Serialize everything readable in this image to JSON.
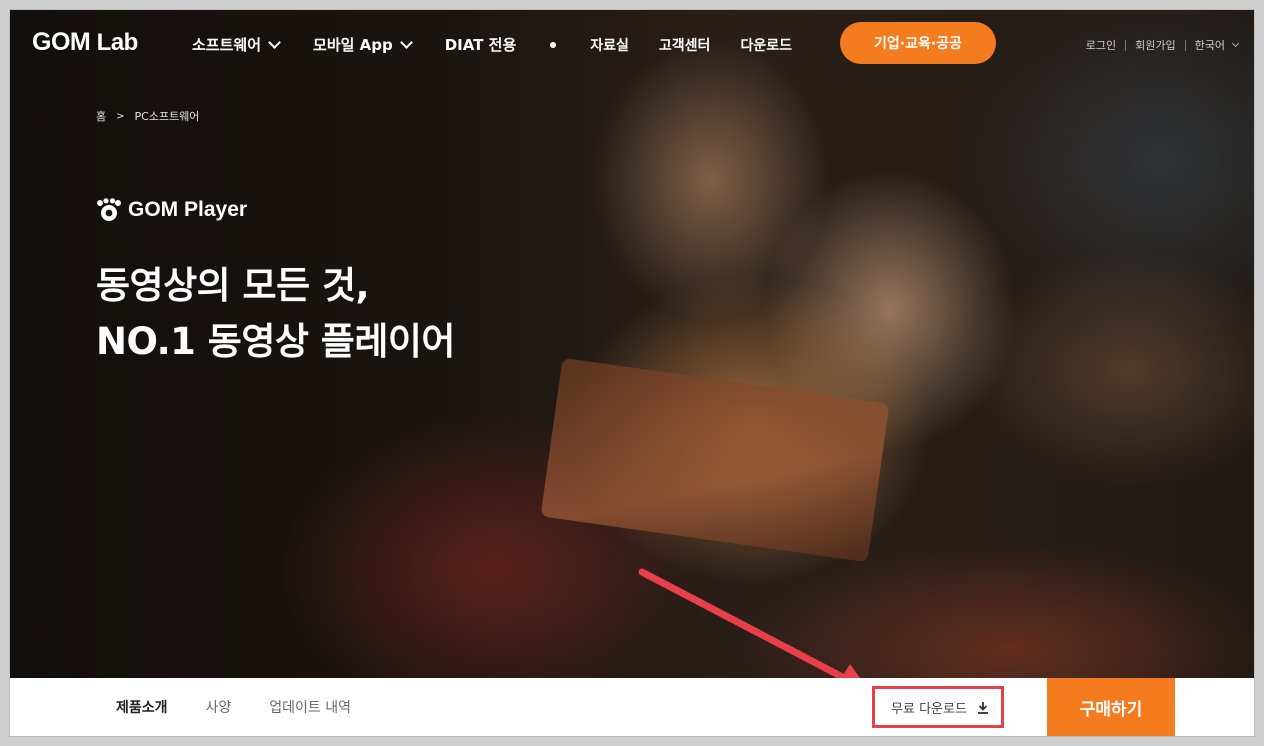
{
  "nav": {
    "logo_main": "GOM",
    "logo_sub": "Lab",
    "menu": [
      {
        "label": "소프트웨어"
      },
      {
        "label": "모바일 App"
      },
      {
        "label": "DIAT 전용"
      }
    ],
    "links": [
      "자료실",
      "고객센터",
      "다운로드"
    ],
    "cta_label": "기업·교육·공공",
    "util": {
      "login": "로그인",
      "signup": "회원가입",
      "language": "한국어"
    }
  },
  "breadcrumb": {
    "home": "홈",
    "separator": ">",
    "current": "PC소프트웨어"
  },
  "product": {
    "name": "GOM Player"
  },
  "headline": {
    "line1": "동영상의 모든 것,",
    "line2": "NO.1 동영상 플레이어"
  },
  "subnav": {
    "tabs": [
      {
        "label": "제품소개",
        "active": true
      },
      {
        "label": "사양",
        "active": false
      },
      {
        "label": "업데이트 내역",
        "active": false
      }
    ],
    "download_label": "무료 다운로드",
    "buy_label": "구매하기"
  },
  "colors": {
    "accent": "#f47b1e",
    "annotation": "#e8404b"
  }
}
